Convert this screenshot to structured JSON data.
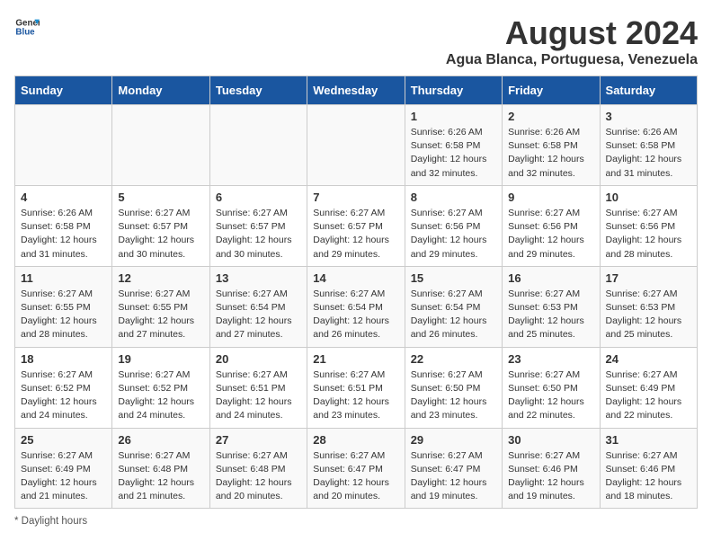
{
  "logo": {
    "general": "General",
    "blue": "Blue"
  },
  "title": "August 2024",
  "location": "Agua Blanca, Portuguesa, Venezuela",
  "days_of_week": [
    "Sunday",
    "Monday",
    "Tuesday",
    "Wednesday",
    "Thursday",
    "Friday",
    "Saturday"
  ],
  "footer": "Daylight hours",
  "weeks": [
    [
      {
        "day": "",
        "info": ""
      },
      {
        "day": "",
        "info": ""
      },
      {
        "day": "",
        "info": ""
      },
      {
        "day": "",
        "info": ""
      },
      {
        "day": "1",
        "info": "Sunrise: 6:26 AM\nSunset: 6:58 PM\nDaylight: 12 hours\nand 32 minutes."
      },
      {
        "day": "2",
        "info": "Sunrise: 6:26 AM\nSunset: 6:58 PM\nDaylight: 12 hours\nand 32 minutes."
      },
      {
        "day": "3",
        "info": "Sunrise: 6:26 AM\nSunset: 6:58 PM\nDaylight: 12 hours\nand 31 minutes."
      }
    ],
    [
      {
        "day": "4",
        "info": "Sunrise: 6:26 AM\nSunset: 6:58 PM\nDaylight: 12 hours\nand 31 minutes."
      },
      {
        "day": "5",
        "info": "Sunrise: 6:27 AM\nSunset: 6:57 PM\nDaylight: 12 hours\nand 30 minutes."
      },
      {
        "day": "6",
        "info": "Sunrise: 6:27 AM\nSunset: 6:57 PM\nDaylight: 12 hours\nand 30 minutes."
      },
      {
        "day": "7",
        "info": "Sunrise: 6:27 AM\nSunset: 6:57 PM\nDaylight: 12 hours\nand 29 minutes."
      },
      {
        "day": "8",
        "info": "Sunrise: 6:27 AM\nSunset: 6:56 PM\nDaylight: 12 hours\nand 29 minutes."
      },
      {
        "day": "9",
        "info": "Sunrise: 6:27 AM\nSunset: 6:56 PM\nDaylight: 12 hours\nand 29 minutes."
      },
      {
        "day": "10",
        "info": "Sunrise: 6:27 AM\nSunset: 6:56 PM\nDaylight: 12 hours\nand 28 minutes."
      }
    ],
    [
      {
        "day": "11",
        "info": "Sunrise: 6:27 AM\nSunset: 6:55 PM\nDaylight: 12 hours\nand 28 minutes."
      },
      {
        "day": "12",
        "info": "Sunrise: 6:27 AM\nSunset: 6:55 PM\nDaylight: 12 hours\nand 27 minutes."
      },
      {
        "day": "13",
        "info": "Sunrise: 6:27 AM\nSunset: 6:54 PM\nDaylight: 12 hours\nand 27 minutes."
      },
      {
        "day": "14",
        "info": "Sunrise: 6:27 AM\nSunset: 6:54 PM\nDaylight: 12 hours\nand 26 minutes."
      },
      {
        "day": "15",
        "info": "Sunrise: 6:27 AM\nSunset: 6:54 PM\nDaylight: 12 hours\nand 26 minutes."
      },
      {
        "day": "16",
        "info": "Sunrise: 6:27 AM\nSunset: 6:53 PM\nDaylight: 12 hours\nand 25 minutes."
      },
      {
        "day": "17",
        "info": "Sunrise: 6:27 AM\nSunset: 6:53 PM\nDaylight: 12 hours\nand 25 minutes."
      }
    ],
    [
      {
        "day": "18",
        "info": "Sunrise: 6:27 AM\nSunset: 6:52 PM\nDaylight: 12 hours\nand 24 minutes."
      },
      {
        "day": "19",
        "info": "Sunrise: 6:27 AM\nSunset: 6:52 PM\nDaylight: 12 hours\nand 24 minutes."
      },
      {
        "day": "20",
        "info": "Sunrise: 6:27 AM\nSunset: 6:51 PM\nDaylight: 12 hours\nand 24 minutes."
      },
      {
        "day": "21",
        "info": "Sunrise: 6:27 AM\nSunset: 6:51 PM\nDaylight: 12 hours\nand 23 minutes."
      },
      {
        "day": "22",
        "info": "Sunrise: 6:27 AM\nSunset: 6:50 PM\nDaylight: 12 hours\nand 23 minutes."
      },
      {
        "day": "23",
        "info": "Sunrise: 6:27 AM\nSunset: 6:50 PM\nDaylight: 12 hours\nand 22 minutes."
      },
      {
        "day": "24",
        "info": "Sunrise: 6:27 AM\nSunset: 6:49 PM\nDaylight: 12 hours\nand 22 minutes."
      }
    ],
    [
      {
        "day": "25",
        "info": "Sunrise: 6:27 AM\nSunset: 6:49 PM\nDaylight: 12 hours\nand 21 minutes."
      },
      {
        "day": "26",
        "info": "Sunrise: 6:27 AM\nSunset: 6:48 PM\nDaylight: 12 hours\nand 21 minutes."
      },
      {
        "day": "27",
        "info": "Sunrise: 6:27 AM\nSunset: 6:48 PM\nDaylight: 12 hours\nand 20 minutes."
      },
      {
        "day": "28",
        "info": "Sunrise: 6:27 AM\nSunset: 6:47 PM\nDaylight: 12 hours\nand 20 minutes."
      },
      {
        "day": "29",
        "info": "Sunrise: 6:27 AM\nSunset: 6:47 PM\nDaylight: 12 hours\nand 19 minutes."
      },
      {
        "day": "30",
        "info": "Sunrise: 6:27 AM\nSunset: 6:46 PM\nDaylight: 12 hours\nand 19 minutes."
      },
      {
        "day": "31",
        "info": "Sunrise: 6:27 AM\nSunset: 6:46 PM\nDaylight: 12 hours\nand 18 minutes."
      }
    ]
  ]
}
